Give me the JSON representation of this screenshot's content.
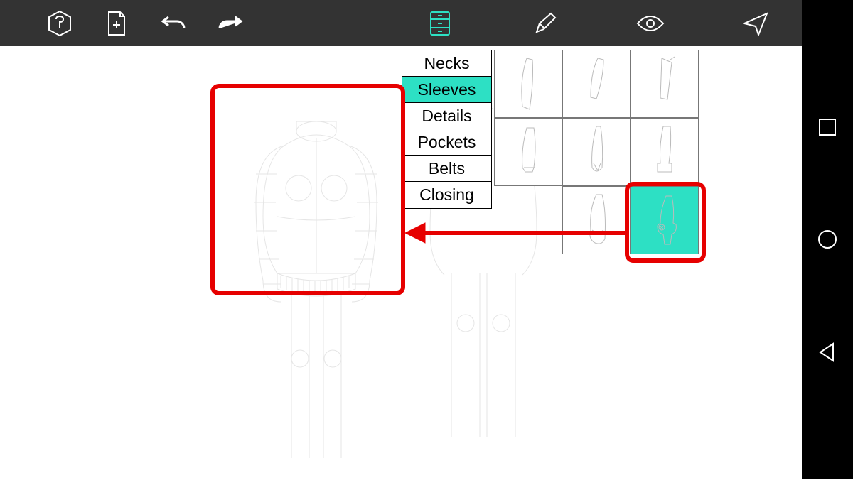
{
  "menu": {
    "items": [
      {
        "label": "Necks",
        "selected": false
      },
      {
        "label": "Sleeves",
        "selected": true
      },
      {
        "label": "Details",
        "selected": false
      },
      {
        "label": "Pockets",
        "selected": false
      },
      {
        "label": "Belts",
        "selected": false
      },
      {
        "label": "Closing",
        "selected": false
      }
    ]
  },
  "grid": {
    "rows": 3,
    "cols": 3,
    "selected_index": 8
  },
  "toolbar": {
    "logo": "logo",
    "new": "new",
    "undo": "undo",
    "redo": "redo",
    "cabinet": "cabinet",
    "pencil": "pencil",
    "eye": "eye",
    "send": "send"
  },
  "colors": {
    "accent": "#2de0c4",
    "highlight": "#e60000",
    "toolbar": "#333333"
  }
}
